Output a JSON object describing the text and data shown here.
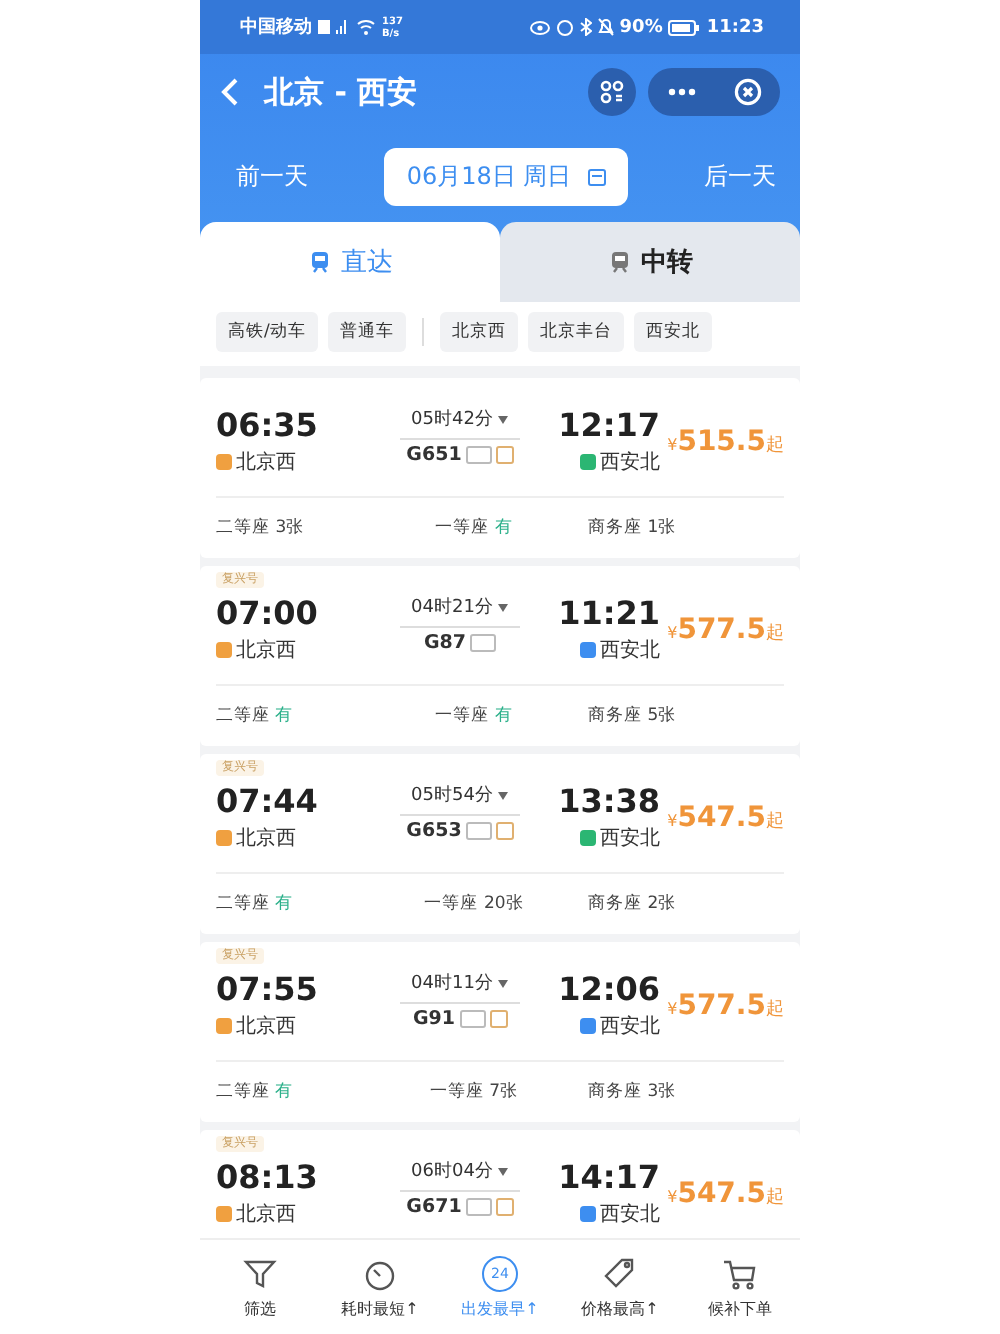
{
  "status_bar": {
    "carrier": "中国移动",
    "speed_value": "137",
    "speed_unit": "B/s",
    "battery": "90%",
    "time": "11:23"
  },
  "header": {
    "title": "北京 - 西安"
  },
  "date_bar": {
    "prev": "前一天",
    "date": "06月18日 周日",
    "next": "后一天"
  },
  "tabs": [
    {
      "label": "直达",
      "selected": true
    },
    {
      "label": "中转",
      "selected": false
    }
  ],
  "filter_groups": [
    {
      "chips": [
        "高铁/动车",
        "普通车"
      ]
    },
    {
      "chips": [
        "北京西",
        "北京丰台",
        "西安北"
      ]
    }
  ],
  "trains": [
    {
      "depart": "06:35",
      "from": {
        "name": "北京西",
        "color": "#f0a040"
      },
      "duration": "05时42分",
      "number": "G651",
      "extra_badge": true,
      "arrive": "12:17",
      "to": {
        "name": "西安北",
        "color": "#2bb673"
      },
      "currency": "¥",
      "price": "515.5",
      "suffix": "起",
      "seats": [
        {
          "class": "二等座",
          "count": "3张",
          "available": false
        },
        {
          "class": "一等座",
          "count": "有",
          "available": true
        },
        {
          "class": "商务座",
          "count": "1张",
          "available": false
        }
      ]
    },
    {
      "tag": "复兴号",
      "depart": "07:00",
      "from": {
        "name": "北京西",
        "color": "#f0a040"
      },
      "duration": "04时21分",
      "number": "G87",
      "extra_badge": false,
      "arrive": "11:21",
      "to": {
        "name": "西安北",
        "color": "#3d8ef0"
      },
      "currency": "¥",
      "price": "577.5",
      "suffix": "起",
      "seats": [
        {
          "class": "二等座",
          "count": "有",
          "available": true
        },
        {
          "class": "一等座",
          "count": "有",
          "available": true
        },
        {
          "class": "商务座",
          "count": "5张",
          "available": false
        }
      ]
    },
    {
      "tag": "复兴号",
      "depart": "07:44",
      "from": {
        "name": "北京西",
        "color": "#f0a040"
      },
      "duration": "05时54分",
      "number": "G653",
      "extra_badge": true,
      "arrive": "13:38",
      "to": {
        "name": "西安北",
        "color": "#2bb673"
      },
      "currency": "¥",
      "price": "547.5",
      "suffix": "起",
      "seats": [
        {
          "class": "二等座",
          "count": "有",
          "available": true
        },
        {
          "class": "一等座",
          "count": "20张",
          "available": false
        },
        {
          "class": "商务座",
          "count": "2张",
          "available": false
        }
      ]
    },
    {
      "tag": "复兴号",
      "depart": "07:55",
      "from": {
        "name": "北京西",
        "color": "#f0a040"
      },
      "duration": "04时11分",
      "number": "G91",
      "extra_badge": true,
      "arrive": "12:06",
      "to": {
        "name": "西安北",
        "color": "#3d8ef0"
      },
      "currency": "¥",
      "price": "577.5",
      "suffix": "起",
      "seats": [
        {
          "class": "二等座",
          "count": "有",
          "available": true
        },
        {
          "class": "一等座",
          "count": "7张",
          "available": false
        },
        {
          "class": "商务座",
          "count": "3张",
          "available": false
        }
      ]
    },
    {
      "tag": "复兴号",
      "depart": "08:13",
      "from": {
        "name": "北京西",
        "color": "#f0a040"
      },
      "duration": "06时04分",
      "number": "G671",
      "extra_badge": true,
      "arrive": "14:17",
      "to": {
        "name": "西安北",
        "color": "#3d8ef0"
      },
      "currency": "¥",
      "price": "547.5",
      "suffix": "起"
    }
  ],
  "bottom_nav": [
    {
      "label": "筛选",
      "kind": "filter",
      "selected": false
    },
    {
      "label": "耗时最短↑",
      "kind": "timer",
      "selected": false
    },
    {
      "label": "出发最早↑",
      "kind": "clock",
      "badge": "24",
      "selected": true
    },
    {
      "label": "价格最高↑",
      "kind": "tag",
      "selected": false
    },
    {
      "label": "候补下单",
      "kind": "cart",
      "selected": false
    }
  ]
}
